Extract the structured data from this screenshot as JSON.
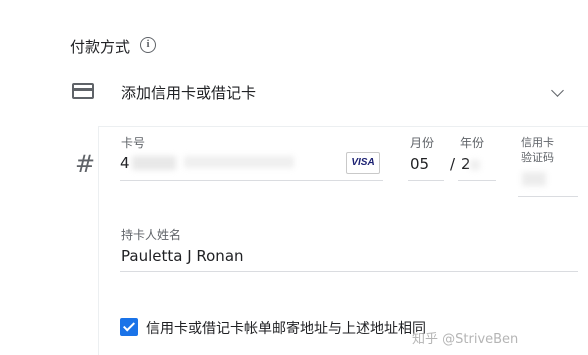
{
  "payment": {
    "section_title": "付款方式",
    "info_icon_glyph": "i",
    "add_card_label": "添加信用卡或借记卡"
  },
  "card_form": {
    "number_label": "卡号",
    "number_value_prefix": "4",
    "card_brand": "VISA",
    "month_label": "月份",
    "month_value": "05",
    "year_label": "年份",
    "year_separator": "/",
    "year_value_prefix": "2",
    "cvc_label_line1": "信用卡",
    "cvc_label_line2": "验证码",
    "hash_glyph": "#",
    "holder_label": "持卡人姓名",
    "holder_value": "Pauletta J Ronan"
  },
  "billing": {
    "same_address_checked": true,
    "same_address_label": "信用卡或借记卡帐单邮寄地址与上述地址相同"
  },
  "watermark": "知乎 @StriveBen",
  "colors": {
    "accent": "#1a73e8",
    "icon_gray": "#5f6368",
    "text": "#202124",
    "divider": "#dadce0"
  }
}
